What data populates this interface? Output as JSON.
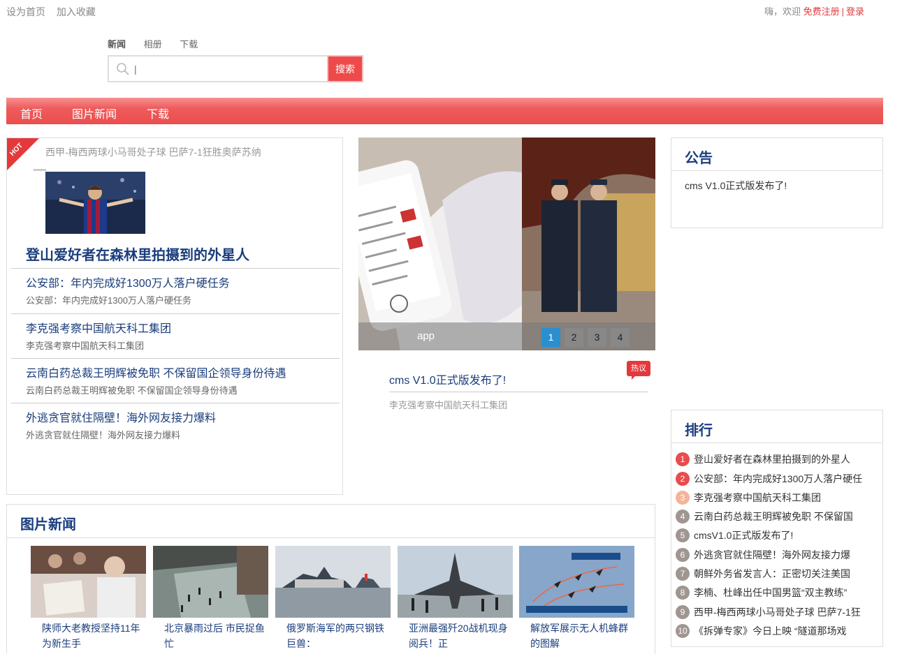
{
  "topbar": {
    "set_home": "设为首页",
    "add_fav": "加入收藏",
    "greeting": "嗨，欢迎",
    "register": "免费注册",
    "separator": "|",
    "login": "登录"
  },
  "search": {
    "tabs": [
      "新闻",
      "相册",
      "下载"
    ],
    "active_tab": "新闻",
    "value": "",
    "placeholder": "|",
    "button": "搜索"
  },
  "nav": {
    "items": [
      "首页",
      "图片新闻",
      "下载"
    ]
  },
  "hot": {
    "badge": "HOT",
    "headline": "西甲-梅西两球小马哥处子球 巴萨7-1狂胜奥萨苏纳",
    "feature_title": "登山爱好者在森林里拍摄到的外星人",
    "items": [
      {
        "title": "公安部：年内完成好1300万人落户硬任务",
        "desc": "公安部：年内完成好1300万人落户硬任务"
      },
      {
        "title": "李克强考察中国航天科工集团",
        "desc": "李克强考察中国航天科工集团"
      },
      {
        "title": "云南白药总裁王明辉被免职 不保留国企领导身份待遇",
        "desc": "云南白药总裁王明辉被免职 不保留国企领导身份待遇"
      },
      {
        "title": "外逃贪官就住隔壁！海外网友接力爆料",
        "desc": "外逃贪官就住隔壁！海外网友接力爆料"
      }
    ]
  },
  "slider": {
    "caption": "app",
    "dots": [
      "1",
      "2",
      "3",
      "4"
    ],
    "active": 1
  },
  "mid_news": {
    "badge": "热议",
    "title": "cms V1.0正式版发布了!",
    "desc": "李克强考察中国航天科工集团"
  },
  "notice": {
    "title": "公告",
    "body": "cms V1.0正式版发布了!"
  },
  "rank": {
    "title": "排行",
    "items": [
      {
        "num": "1",
        "text": "登山爱好者在森林里拍摄到的外星人",
        "color": "#e84c4c"
      },
      {
        "num": "2",
        "text": "公安部：年内完成好1300万人落户硬任",
        "color": "#e84c4c"
      },
      {
        "num": "3",
        "text": "李克强考察中国航天科工集团",
        "color": "#f3b49a"
      },
      {
        "num": "4",
        "text": "云南白药总裁王明辉被免职 不保留国",
        "color": "#a09590"
      },
      {
        "num": "5",
        "text": "cmsV1.0正式版发布了!",
        "color": "#a09590"
      },
      {
        "num": "6",
        "text": "外逃贪官就住隔壁！海外网友接力爆",
        "color": "#a09590"
      },
      {
        "num": "7",
        "text": "朝鲜外务省发言人：正密切关注美国",
        "color": "#a09590"
      },
      {
        "num": "8",
        "text": "李楠、杜峰出任中国男篮“双主教练”",
        "color": "#a09590"
      },
      {
        "num": "9",
        "text": "西甲-梅西两球小马哥处子球 巴萨7-1狂",
        "color": "#a09590"
      },
      {
        "num": "10",
        "text": "《拆弹专家》今日上映 “隧道那场戏",
        "color": "#a09590"
      }
    ]
  },
  "photos": {
    "title": "图片新闻",
    "items": [
      {
        "caption": "陕师大老教授坚持11年为新生手"
      },
      {
        "caption": "北京暴雨过后 市民捉鱼忙"
      },
      {
        "caption": "俄罗斯海军的两只钢铁巨兽："
      },
      {
        "caption": "亚洲最强歼20战机现身阅兵！正"
      },
      {
        "caption": "解放军展示无人机蜂群的图解"
      }
    ]
  }
}
